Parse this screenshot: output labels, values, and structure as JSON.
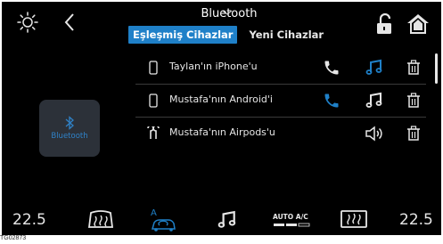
{
  "header": {
    "title": "Bluetooth",
    "tabs": [
      {
        "label": "Eşleşmiş Cihazlar",
        "active": true
      },
      {
        "label": "Yeni Cihazlar",
        "active": false
      }
    ]
  },
  "sidebar": {
    "bluetooth_tile_label": "Bluetooth"
  },
  "devices": [
    {
      "name": "Taylan'ın iPhone'u",
      "device_icon": "phone-icon",
      "phone_active": false,
      "music_active": true,
      "actions": [
        "call-icon",
        "music-icon",
        "delete-icon"
      ]
    },
    {
      "name": "Mustafa'nın Android'i",
      "device_icon": "phone-icon",
      "phone_active": true,
      "music_active": false,
      "actions": [
        "call-icon",
        "music-icon",
        "delete-icon"
      ]
    },
    {
      "name": "Mustafa'nın Airpods'u",
      "device_icon": "earbuds-icon",
      "actions": [
        "speaker-icon",
        "delete-icon"
      ]
    }
  ],
  "climate": {
    "left_temp": "22.5",
    "right_temp": "22.5",
    "auto_ac_label": "AUTO A/C"
  },
  "image_caption": "TG02873",
  "colors": {
    "accent_blue": "#1f80c8",
    "background": "#000000",
    "tile": "#2c3139",
    "text": "#e6e6e6"
  }
}
